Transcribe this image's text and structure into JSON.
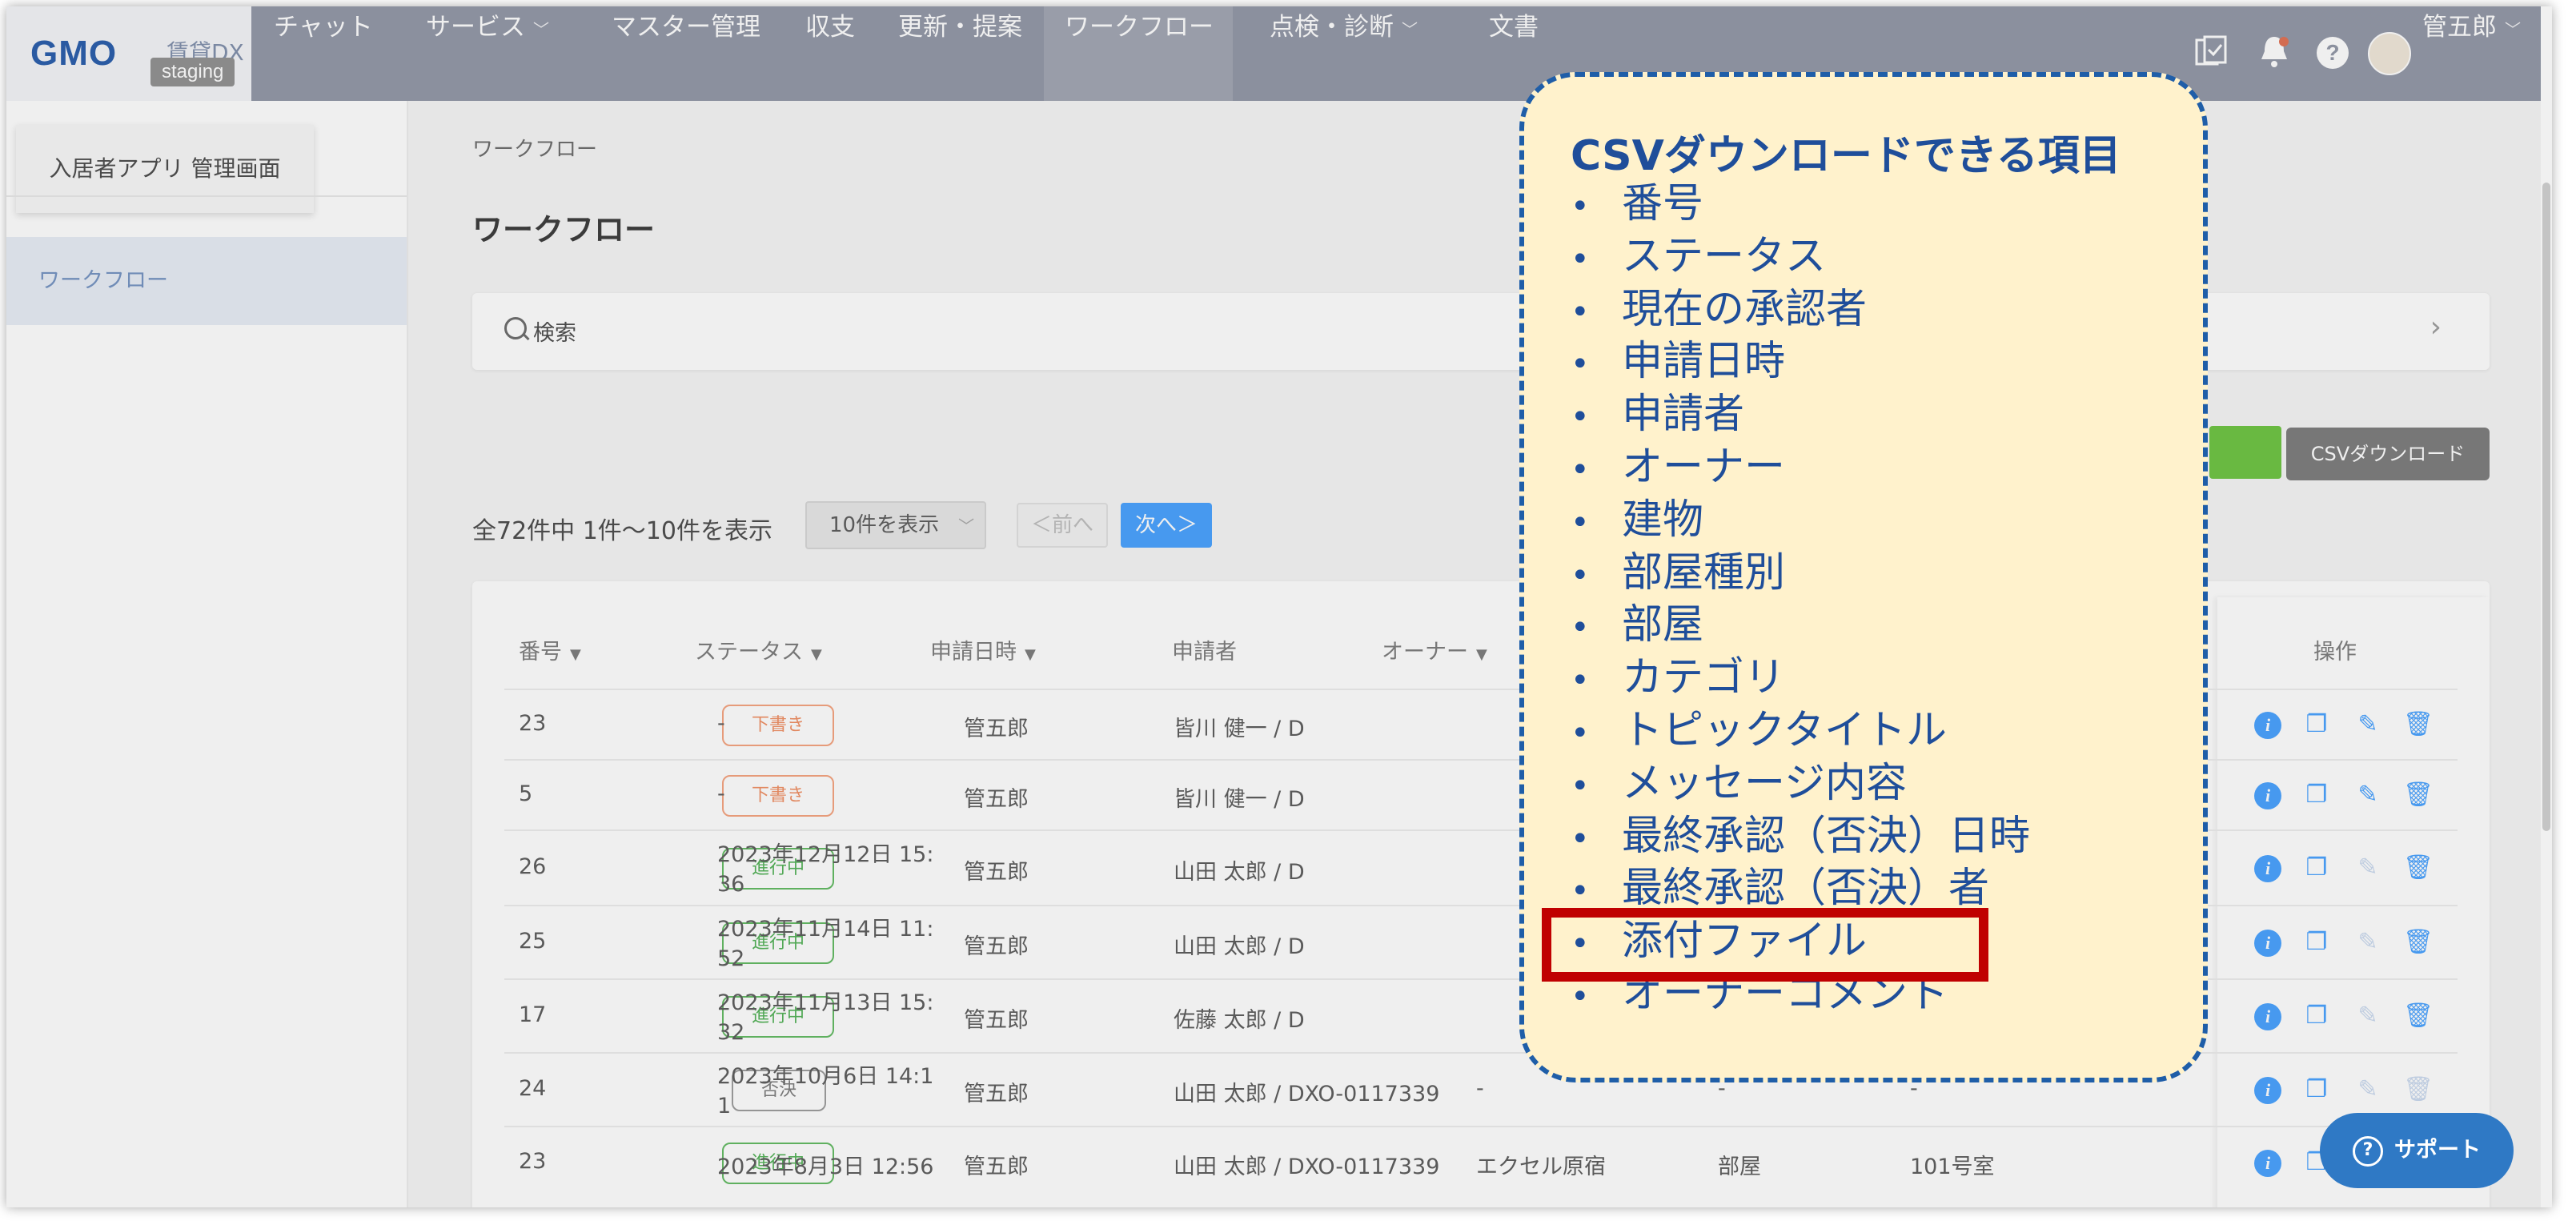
{
  "app": {
    "logo": "GMO",
    "logo_sub": "賃貸DX",
    "env_badge": "staging"
  },
  "nav": {
    "items": [
      {
        "label": "チャット",
        "has_dropdown": false
      },
      {
        "label": "サービス",
        "has_dropdown": true
      },
      {
        "label": "マスター管理",
        "has_dropdown": false
      },
      {
        "label": "収支",
        "has_dropdown": false
      },
      {
        "label": "更新・提案",
        "has_dropdown": false
      },
      {
        "label": "ワークフロー",
        "has_dropdown": false,
        "active": true
      },
      {
        "label": "点検・診断",
        "has_dropdown": true
      },
      {
        "label": "文書",
        "has_dropdown": false
      }
    ],
    "user_name": "管五郎",
    "icons": [
      "task-check-icon",
      "bell-icon",
      "help-icon"
    ]
  },
  "sidebar": {
    "app_tab": "入居者アプリ 管理画面",
    "items": [
      {
        "label": "ワークフロー",
        "active": true
      }
    ]
  },
  "main": {
    "breadcrumb": "ワークフロー",
    "title": "ワークフロー",
    "search_label": "検索",
    "csv_button": "CSVダウンロード",
    "count_text": "全72件中 1件〜10件を表示",
    "per_page": "10件を表示",
    "prev_label": "＜前へ",
    "next_label": "次へ＞",
    "columns": [
      "番号",
      "ステータス",
      "申請日時",
      "申請者",
      "オーナー",
      "操作"
    ],
    "rows": [
      {
        "id": "23",
        "status": "下書き",
        "status_type": "draft",
        "date_line1": "-",
        "date_line2": "",
        "applicant": "管五郎",
        "owner": "皆川 健一 / D",
        "building": "",
        "room_type": "",
        "room": "",
        "edit_enabled": true,
        "delete_enabled": true
      },
      {
        "id": "5",
        "status": "下書き",
        "status_type": "draft",
        "date_line1": "-",
        "date_line2": "",
        "applicant": "管五郎",
        "owner": "皆川 健一 / D",
        "building": "",
        "room_type": "",
        "room": "",
        "edit_enabled": true,
        "delete_enabled": true
      },
      {
        "id": "26",
        "status": "進行中",
        "status_type": "progress",
        "date_line1": "2023年12月12日 15:",
        "date_line2": "36",
        "applicant": "管五郎",
        "owner": "山田 太郎 / D",
        "building": "",
        "room_type": "",
        "room": "",
        "edit_enabled": false,
        "delete_enabled": true
      },
      {
        "id": "25",
        "status": "進行中",
        "status_type": "progress",
        "date_line1": "2023年11月14日 11:",
        "date_line2": "52",
        "applicant": "管五郎",
        "owner": "山田 太郎 / D",
        "building": "",
        "room_type": "",
        "room": "",
        "edit_enabled": false,
        "delete_enabled": true
      },
      {
        "id": "17",
        "status": "進行中",
        "status_type": "progress",
        "date_line1": "2023年11月13日 15:",
        "date_line2": "32",
        "applicant": "管五郎",
        "owner": "佐藤 太郎 / D",
        "building": "",
        "room_type": "",
        "room": "",
        "edit_enabled": false,
        "delete_enabled": true
      },
      {
        "id": "24",
        "status": "否決",
        "status_type": "rejected",
        "date_line1": "2023年10月6日 14:1",
        "date_line2": "1",
        "applicant": "管五郎",
        "owner": "山田 太郎 / DXO-0117339",
        "building": "-",
        "room_type": "-",
        "room": "-",
        "edit_enabled": false,
        "delete_enabled": false
      },
      {
        "id": "23",
        "status": "進行中",
        "status_type": "progress",
        "date_line1": "2023年8月3日 12:56",
        "date_line2": "",
        "applicant": "管五郎",
        "owner": "山田 太郎 / DXO-0117339",
        "building": "エクセル原宿",
        "room_type": "部屋",
        "room": "101号室",
        "edit_enabled": false,
        "delete_enabled": true
      }
    ]
  },
  "support_button": "サポート",
  "callout": {
    "title": "CSVダウンロードできる項目",
    "items": [
      "番号",
      "ステータス",
      "現在の承認者",
      "申請日時",
      "申請者",
      "オーナー",
      "建物",
      "部屋種別",
      "部屋",
      "カテゴリ",
      "トピックタイトル",
      "メッセージ内容",
      "最終承認（否決）日時",
      "最終承認（否決）者",
      "添付ファイル",
      "オーナーコメント"
    ],
    "highlighted_item": "添付ファイル"
  },
  "colors": {
    "nav_bg": "#8e93a3",
    "accent_blue": "#409eff",
    "callout_bg": "#fff2cc",
    "callout_text": "#1f4e9a",
    "highlight_red": "#c00000"
  }
}
